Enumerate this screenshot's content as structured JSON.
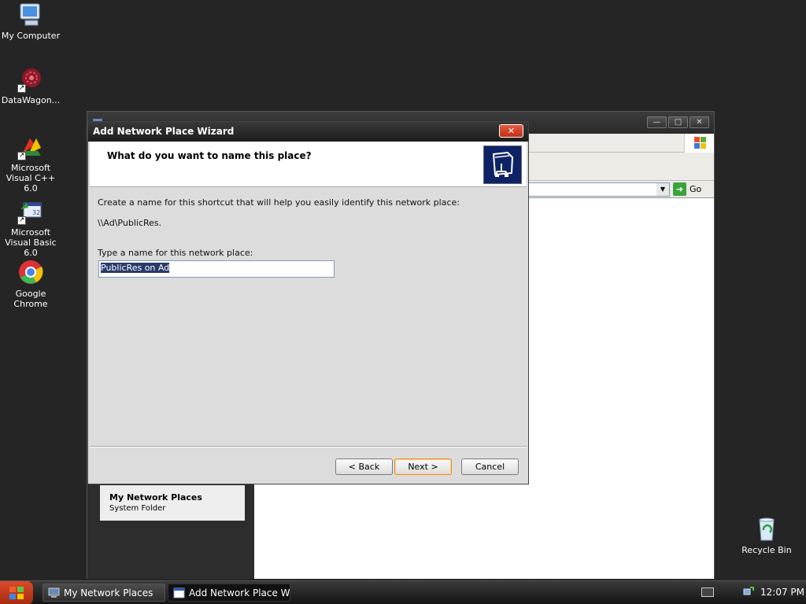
{
  "desktop": {
    "icons": [
      {
        "label": "My Computer",
        "icon": "computer-icon"
      },
      {
        "label": "DataWagon...",
        "icon": "datawagon-icon"
      },
      {
        "label": "Microsoft Visual C++ 6.0",
        "icon": "visual-cpp-icon"
      },
      {
        "label": "Microsoft Visual Basic 6.0",
        "icon": "visual-basic-icon"
      },
      {
        "label": "Google Chrome",
        "icon": "chrome-icon"
      },
      {
        "label": "Recycle Bin",
        "icon": "recycle-bin-icon"
      }
    ]
  },
  "explorer": {
    "window_controls": {
      "minimize": "—",
      "maximize": "□",
      "close": "✕"
    },
    "address": {
      "go_label": "Go"
    },
    "details": {
      "title": "My Network Places",
      "subtitle": "System Folder"
    }
  },
  "wizard": {
    "title": "Add Network Place Wizard",
    "close_glyph": "✕",
    "question": "What do you want to name this place?",
    "description": "Create a name for this shortcut that will help you easily identify this network place:",
    "path": "\\\\Ad\\PublicRes.",
    "name_label": "Type a name for this network place:",
    "name_value": "PublicRes on Ad",
    "buttons": {
      "back": "< Back",
      "next": "Next >",
      "cancel": "Cancel"
    }
  },
  "taskbar": {
    "tasks": [
      {
        "label": "My Network Places",
        "active": false
      },
      {
        "label": "Add Network Place Wi...",
        "active": true
      }
    ],
    "clock": "12:07 PM"
  },
  "colors": {
    "desktop": "#252525",
    "title_bar": "#1c1c1c",
    "close_button": "#c12e12",
    "default_button_border": "#e68b2c",
    "wizard_logo": "#0e2266"
  }
}
